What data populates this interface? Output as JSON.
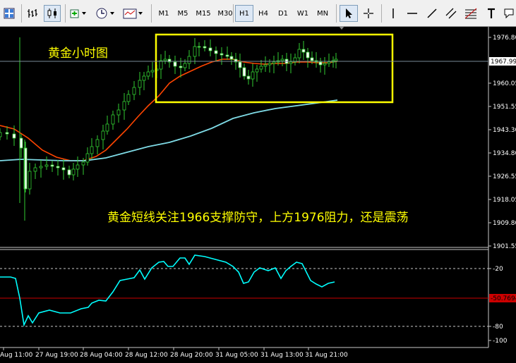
{
  "toolbar": {
    "timeframes": [
      "M1",
      "M5",
      "M15",
      "M30",
      "H1",
      "H4",
      "D1",
      "W1",
      "MN"
    ],
    "active_timeframe": "H1"
  },
  "chart_data": [
    {
      "type": "candlestick",
      "title": "黄金小时图",
      "annotation": "黄金短线关注1966支撑防守，上方1976阻力，还是震荡",
      "current_price": "1967.99",
      "y_ticks": [
        "1976.80",
        "1968.20",
        "1960.05",
        "1951.55",
        "1943.30",
        "1934.80",
        "1926.55",
        "1918.05",
        "1909.80",
        "1901.55"
      ],
      "ylim": [
        1901.55,
        1976.8
      ],
      "series": [
        {
          "name": "MA fast",
          "color": "#ff4500"
        },
        {
          "name": "MA slow",
          "color": "#7fdbe6"
        }
      ],
      "highlight_box_color": "#ffff00"
    },
    {
      "type": "line",
      "y_ticks": [
        "-20",
        "-80",
        "-100"
      ],
      "level_label": "-50.7694",
      "ylim": [
        -100,
        0
      ],
      "color": "#00ffff"
    }
  ],
  "x_axis_labels": [
    "Aug 11:00",
    "27 Aug 19:00",
    "28 Aug 04:00",
    "28 Aug 12:00",
    "28 Aug 20:00",
    "31 Aug 05:00",
    "31 Aug 13:00",
    "31 Aug 21:00"
  ]
}
